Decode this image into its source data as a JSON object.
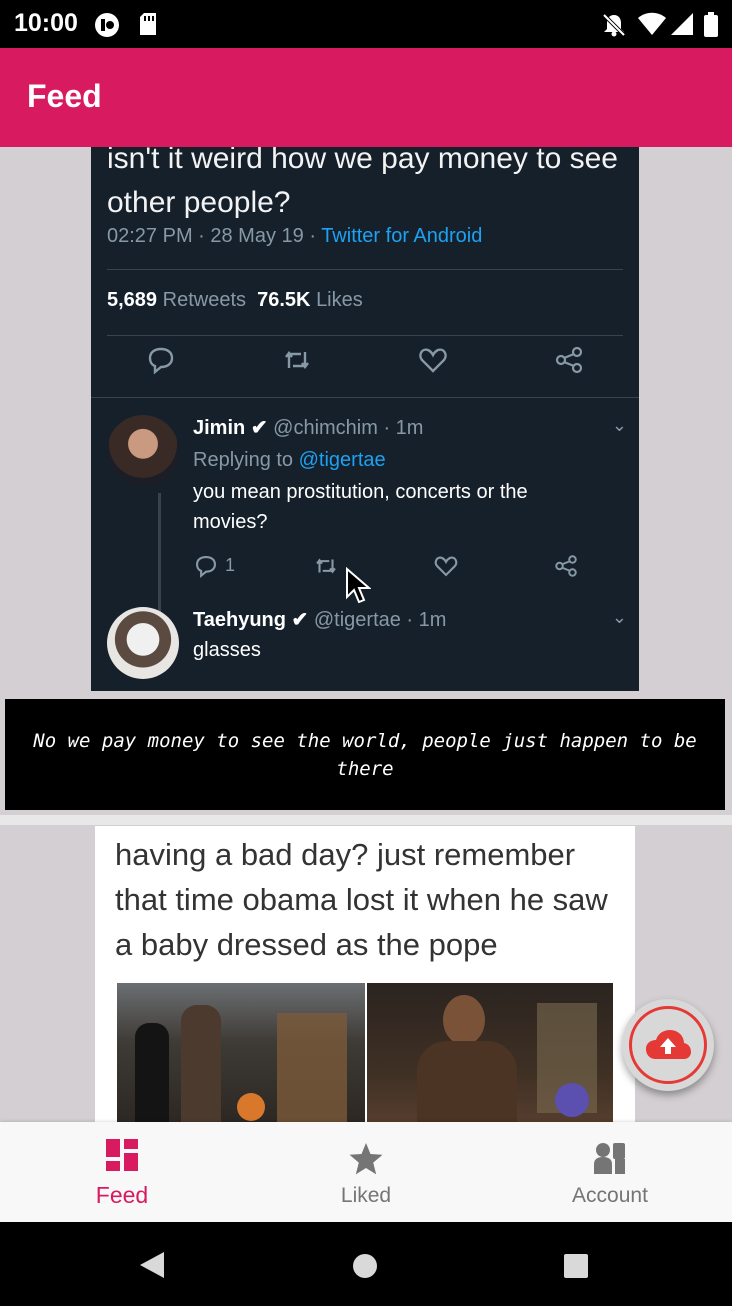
{
  "status_bar": {
    "time": "10:00"
  },
  "app_bar": {
    "title": "Feed"
  },
  "feed": {
    "posts": [
      {
        "tweet": {
          "text": "isn't it weird how we pay money to see other people?",
          "timestamp": "02:27 PM · 28 May 19 · ",
          "client": "Twitter for Android",
          "retweets_count": "5,689",
          "retweets_label": "Retweets",
          "likes_count": "76.5K",
          "likes_label": "Likes",
          "replies": [
            {
              "name": "Jimin",
              "handle": "@chimchim · 1m",
              "replying_to_prefix": "Replying to ",
              "replying_to": "@tigertae",
              "text_line1": "you mean prostitution, concerts or the",
              "text_line2": "movies?",
              "reply_count": "1"
            },
            {
              "name": "Taehyung",
              "handle": "@tigertae · 1m",
              "text_line1": "glasses"
            }
          ]
        },
        "caption": "No we pay money to see the world, people just happen to be there"
      },
      {
        "meme_text": "having a bad day? just remember that time obama lost it when he saw a baby dressed as the pope"
      }
    ]
  },
  "fab": {
    "icon": "cloud-upload-icon"
  },
  "bottom_nav": {
    "items": [
      {
        "label": "Feed",
        "icon": "dashboard-icon",
        "active": true
      },
      {
        "label": "Liked",
        "icon": "star-icon",
        "active": false
      },
      {
        "label": "Account",
        "icon": "account-icon",
        "active": false
      }
    ]
  },
  "colors": {
    "primary": "#d81b60",
    "nav_inactive": "#757575",
    "fab_ring": "#e53935"
  }
}
